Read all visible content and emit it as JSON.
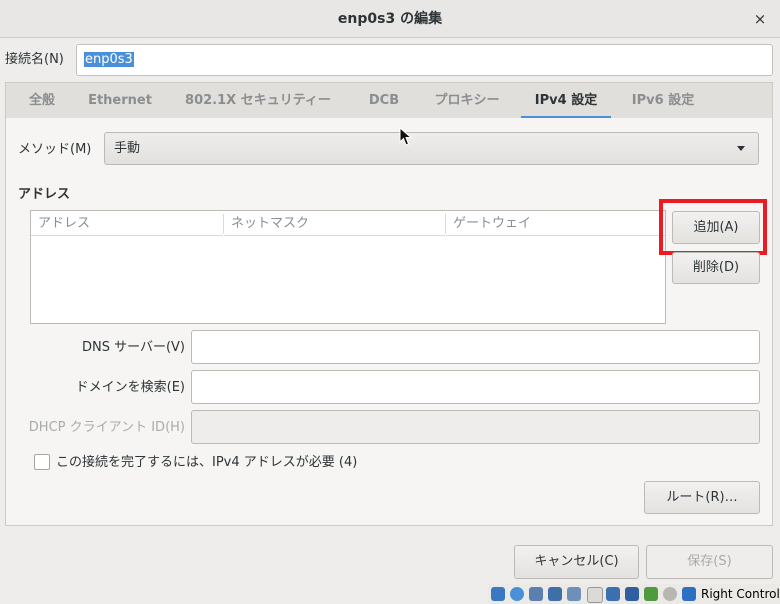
{
  "window": {
    "title": "enp0s3 の編集",
    "close_glyph": "×"
  },
  "connection": {
    "label": "接続名(N)",
    "value": "enp0s3"
  },
  "tabs": [
    {
      "label": "全般",
      "active": false
    },
    {
      "label": "Ethernet",
      "active": false
    },
    {
      "label": "802.1X セキュリティー",
      "active": false
    },
    {
      "label": "DCB",
      "active": false
    },
    {
      "label": "プロキシー",
      "active": false
    },
    {
      "label": "IPv4 設定",
      "active": true
    },
    {
      "label": "IPv6 設定",
      "active": false
    }
  ],
  "ipv4": {
    "method_label": "メソッド(M)",
    "method_value": "手動",
    "addresses_heading": "アドレス",
    "columns": [
      "アドレス",
      "ネットマスク",
      "ゲートウェイ"
    ],
    "add_button": "追加(A)",
    "delete_button": "削除(D)",
    "dns_label": "DNS サーバー(V)",
    "dns_value": "",
    "search_label": "ドメインを検索(E)",
    "search_value": "",
    "dhcp_label": "DHCP クライアント ID(H)",
    "dhcp_value": "",
    "require_checkbox_label": "この接続を完了するには、IPv4 アドレスが必要 (4)",
    "require_checked": false,
    "routes_button": "ルート(R)…"
  },
  "footer": {
    "cancel_button": "キャンセル(C)",
    "save_button": "保存(S)"
  },
  "statusbar": {
    "host_key": "Right Control",
    "icons": [
      "hard-disk-icon",
      "optical-drive-icon",
      "audio-icon",
      "network-icon",
      "usb-icon",
      "shared-folders-icon",
      "display-icon",
      "video-capture-icon",
      "guest-additions-icon",
      "mouse-integration-icon",
      "keyboard-icon"
    ]
  },
  "colors": {
    "accent": "#4a90d9",
    "highlight": "#ec1b23"
  }
}
